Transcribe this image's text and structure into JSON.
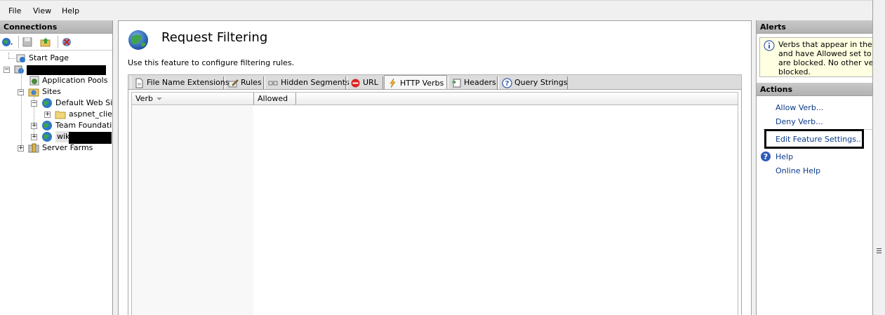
{
  "menu": [
    "File",
    "View",
    "Help"
  ],
  "connections": {
    "title": "Connections",
    "tree": {
      "start_page": "Start Page",
      "app_pools": "Application Pools",
      "sites": "Sites",
      "default_web_site": "Default Web Site",
      "aspnet_client": "aspnet_client",
      "team_foundation": "Team Foundation",
      "wiki": "wiki",
      "server_farms": "Server Farms"
    }
  },
  "feature": {
    "title": "Request Filtering",
    "description": "Use this feature to configure filtering rules.",
    "tabs": [
      {
        "label": "File Name Extensions",
        "icon": "document-icon"
      },
      {
        "label": "Rules",
        "icon": "pencil-icon"
      },
      {
        "label": "Hidden Segments",
        "icon": "segments-icon"
      },
      {
        "label": "URL",
        "icon": "no-entry-icon"
      },
      {
        "label": "HTTP Verbs",
        "icon": "lightning-icon"
      },
      {
        "label": "Headers",
        "icon": "headers-icon"
      },
      {
        "label": "Query Strings",
        "icon": "question-icon"
      }
    ],
    "active_tab": "HTTP Verbs",
    "columns": [
      "Verb",
      "Allowed"
    ]
  },
  "alerts": {
    "title": "Alerts",
    "lines": [
      "Verbs that appear in the list",
      "and have Allowed set to Fals",
      "are blocked. No other verbs",
      "blocked."
    ]
  },
  "actions": {
    "title": "Actions",
    "items": {
      "allow_verb": "Allow Verb...",
      "deny_verb": "Deny Verb...",
      "edit_feature": "Edit Feature Settings...",
      "help": "Help",
      "online_help": "Online Help"
    }
  },
  "colors": {
    "link": "#0a3a8a",
    "alert_bg": "#ffffe1",
    "panel_header": "#b9b9b9"
  }
}
